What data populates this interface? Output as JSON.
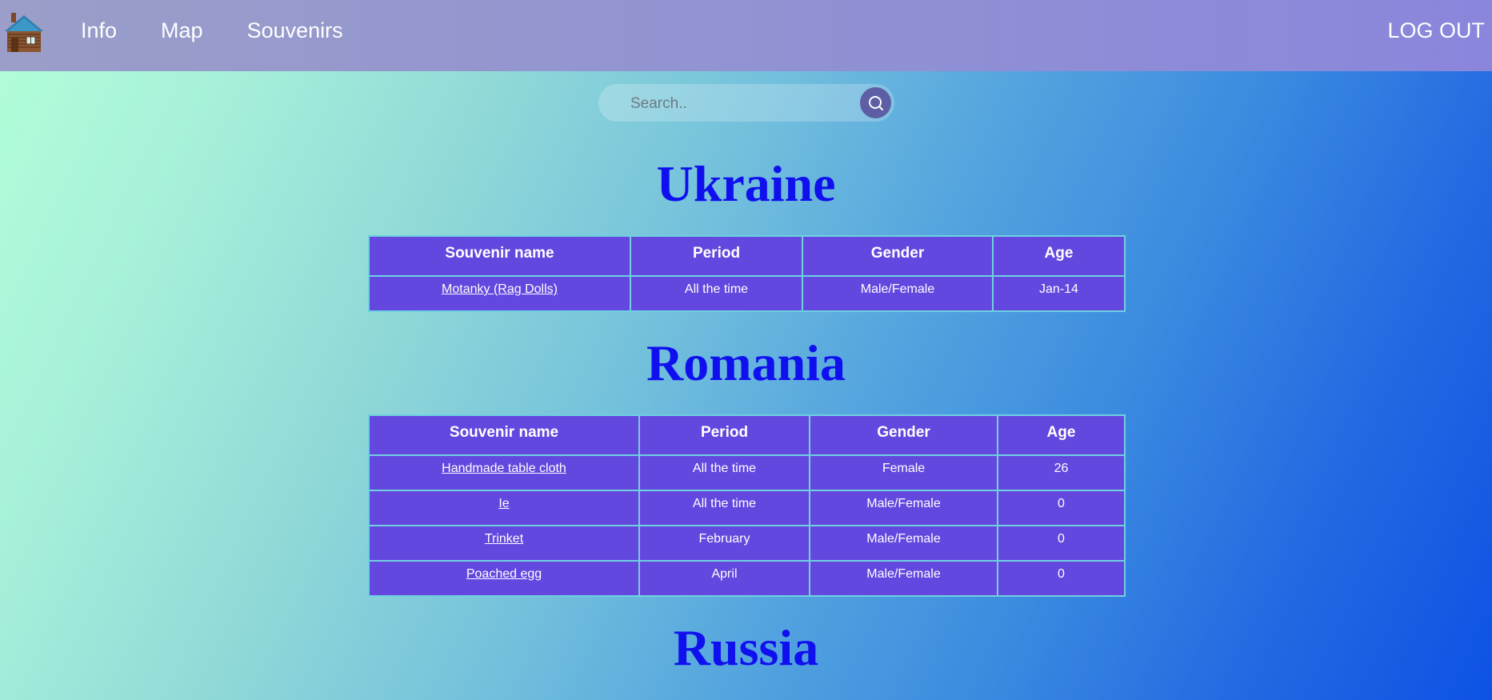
{
  "nav": {
    "links": [
      "Info",
      "Map",
      "Souvenirs"
    ],
    "logout": "LOG OUT"
  },
  "search": {
    "placeholder": "Search..",
    "value": ""
  },
  "columns": [
    "Souvenir name",
    "Period",
    "Gender",
    "Age"
  ],
  "sections": [
    {
      "country": "Ukraine",
      "rows": [
        {
          "name": "Motanky (Rag Dolls)",
          "period": "All the time",
          "gender": "Male/Female",
          "age": "Jan-14"
        }
      ]
    },
    {
      "country": "Romania",
      "rows": [
        {
          "name": "Handmade table cloth",
          "period": "All the time",
          "gender": "Female",
          "age": "26"
        },
        {
          "name": "Ie",
          "period": "All the time",
          "gender": "Male/Female",
          "age": "0"
        },
        {
          "name": "Trinket",
          "period": "February",
          "gender": "Male/Female",
          "age": "0"
        },
        {
          "name": "Poached egg",
          "period": "April",
          "gender": "Male/Female",
          "age": "0"
        }
      ]
    },
    {
      "country": "Russia",
      "rows": []
    }
  ],
  "colors": {
    "table_bg": "#6447de",
    "table_border": "#6fd0e0",
    "title": "#1010ee",
    "navbar": "#9294d1"
  },
  "icons": {
    "logo": "log-cabin-icon",
    "search": "search-icon"
  }
}
